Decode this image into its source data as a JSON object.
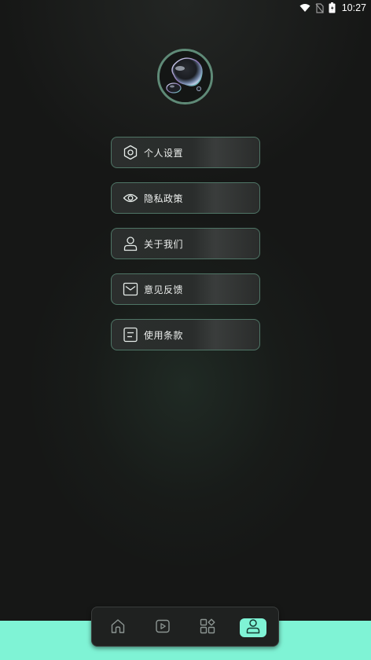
{
  "status_bar": {
    "time": "10:27",
    "icons": [
      "wifi-icon",
      "no-sim-icon",
      "battery-icon"
    ]
  },
  "profile": {
    "avatar": "bubble-avatar"
  },
  "menu": {
    "items": [
      {
        "label": "个人设置",
        "icon": "hexagon-settings-icon"
      },
      {
        "label": "隐私政策",
        "icon": "eye-icon"
      },
      {
        "label": "关于我们",
        "icon": "person-icon"
      },
      {
        "label": "意见反馈",
        "icon": "envelope-icon"
      },
      {
        "label": "使用条款",
        "icon": "document-icon"
      }
    ]
  },
  "tabbar": {
    "tabs": [
      {
        "icon": "home-icon",
        "active": false
      },
      {
        "icon": "play-icon",
        "active": false
      },
      {
        "icon": "apps-icon",
        "active": false
      },
      {
        "icon": "profile-icon",
        "active": true
      }
    ]
  },
  "colors": {
    "accent": "#7ff3d5",
    "item_border": "#4f7566",
    "background": "#161716"
  }
}
